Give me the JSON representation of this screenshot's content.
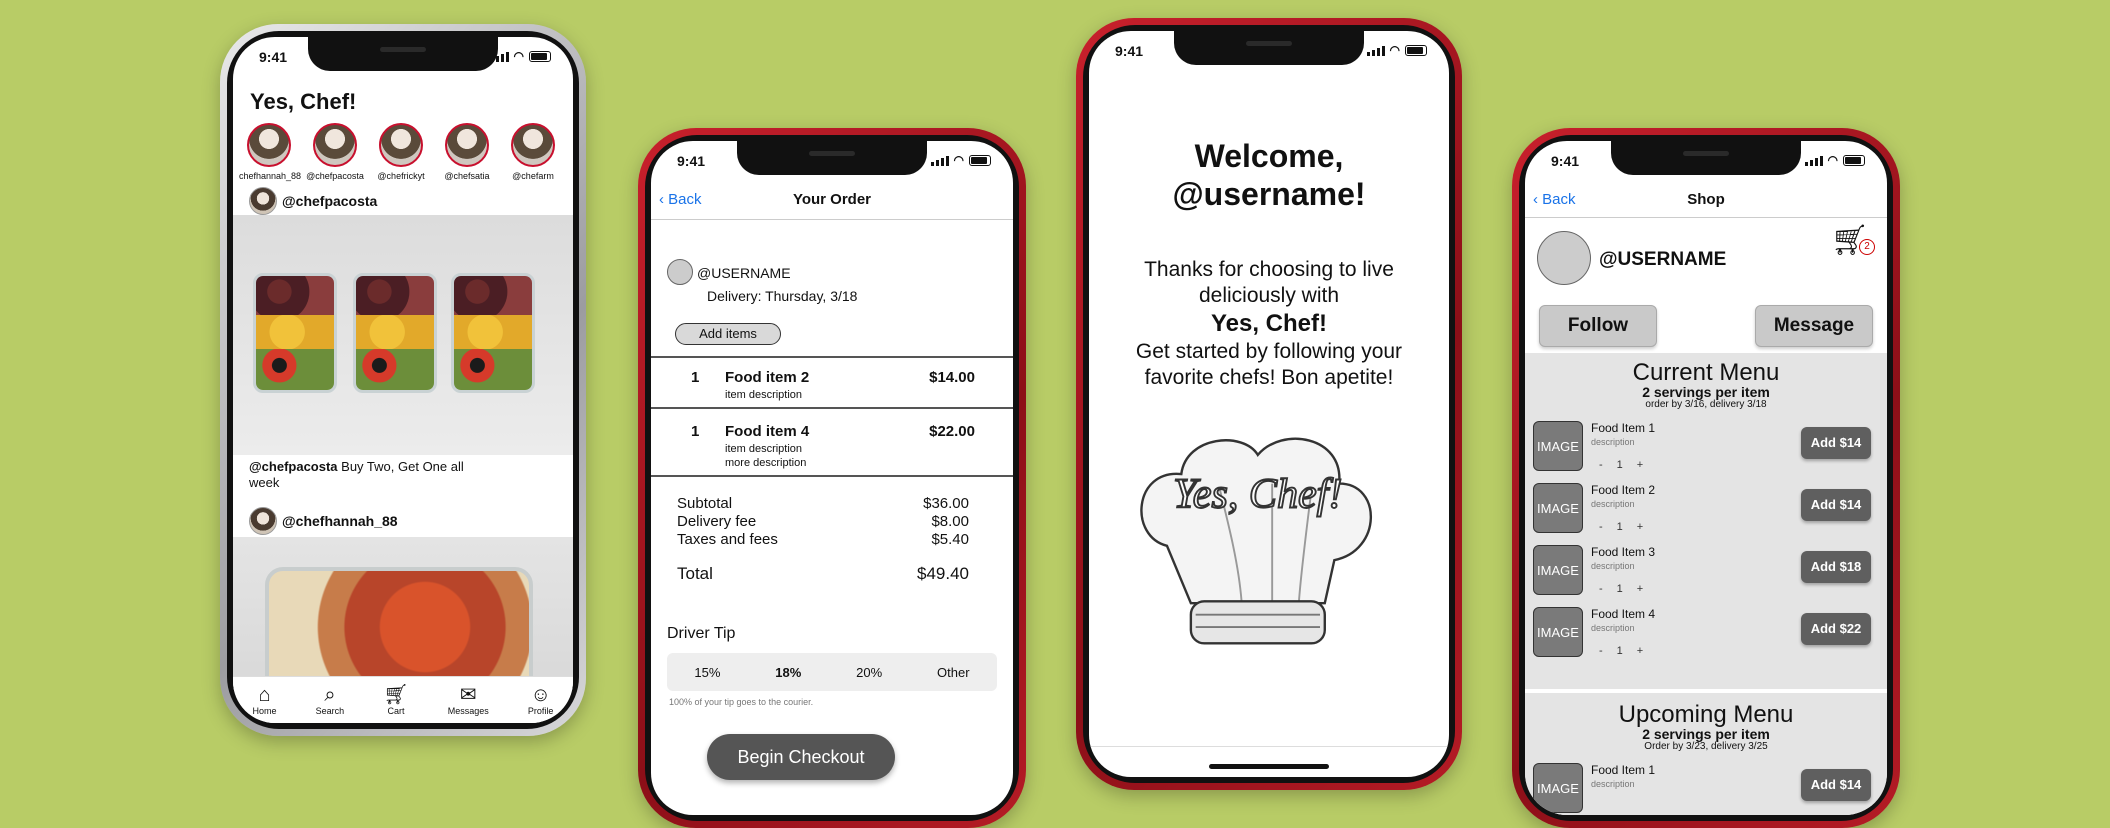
{
  "background_color": "#b8cc66",
  "status_time": "9:41",
  "feed": {
    "title": "Yes, Chef!",
    "stories": [
      "chefhannah_88",
      "@chefpacosta",
      "@chefrickyt",
      "@chefsatia",
      "@chefarm"
    ],
    "post1_user": "@chefpacosta",
    "post1_caption_user": "@chefpacosta",
    "post1_caption_text": " Buy Two, Get One all week",
    "post2_user": "@chefhannah_88",
    "tabs": [
      "Home",
      "Search",
      "Cart",
      "Messages",
      "Profile"
    ]
  },
  "order": {
    "back": "Back",
    "title": "Your Order",
    "username": "@USERNAME",
    "delivery": "Delivery: Thursday, 3/18",
    "add_items": "Add items",
    "items": [
      {
        "qty": "1",
        "name": "Food item 2",
        "desc1": "item description",
        "desc2": "",
        "price": "$14.00"
      },
      {
        "qty": "1",
        "name": "Food item 4",
        "desc1": "item description",
        "desc2": "more description",
        "price": "$22.00"
      }
    ],
    "subtotal_label": "Subtotal",
    "subtotal": "$36.00",
    "delivery_fee_label": "Delivery fee",
    "delivery_fee": "$8.00",
    "taxes_label": "Taxes and fees",
    "taxes": "$5.40",
    "total_label": "Total",
    "total": "$49.40",
    "tip_label": "Driver Tip",
    "tips": [
      "15%",
      "18%",
      "20%",
      "Other"
    ],
    "tip_note": "100% of your tip goes to the courier.",
    "checkout": "Begin Checkout"
  },
  "welcome": {
    "line1": "Welcome,",
    "line2": "@username!",
    "body1": "Thanks for choosing to live deliciously with",
    "brand": "Yes, Chef!",
    "body2": "Get started by following your favorite chefs! Bon apetite!",
    "hat_text": "Yes, Chef!"
  },
  "shop": {
    "back": "Back",
    "title": "Shop",
    "username": "@USERNAME",
    "cart_count": "2",
    "follow": "Follow",
    "message": "Message",
    "current_title": "Current Menu",
    "current_sub": "2 servings per item",
    "current_order": "order by 3/16, delivery 3/18",
    "items": [
      {
        "name": "Food Item 1",
        "desc": "description",
        "qty": "1",
        "add": "Add $14"
      },
      {
        "name": "Food Item 2",
        "desc": "description",
        "qty": "1",
        "add": "Add $14"
      },
      {
        "name": "Food Item 3",
        "desc": "description",
        "qty": "1",
        "add": "Add $18"
      },
      {
        "name": "Food Item 4",
        "desc": "description",
        "qty": "1",
        "add": "Add $22"
      }
    ],
    "image_label": "IMAGE",
    "upcoming_title": "Upcoming Menu",
    "upcoming_sub": "2 servings per item",
    "upcoming_order": "Order by 3/23, delivery 3/25",
    "upcoming_item": {
      "name": "Food Item 1",
      "desc": "description",
      "add": "Add $14"
    }
  }
}
